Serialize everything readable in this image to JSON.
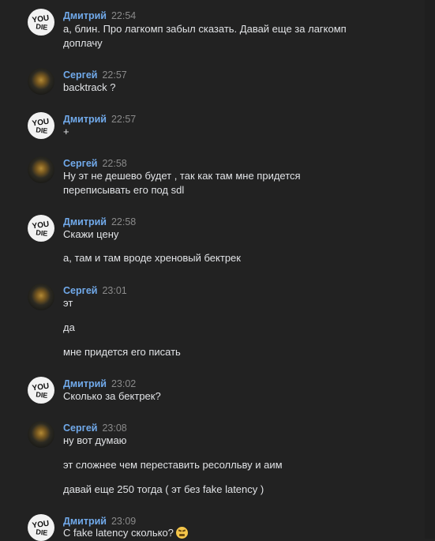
{
  "users": {
    "dmitry": "Дмитрий",
    "sergey": "Сергей"
  },
  "messages": [
    {
      "author": "Дмитрий",
      "time": "22:54",
      "lines": [
        "а, блин. Про лагкомп забыл сказать. Давай еще за лагкомп",
        "доплачу"
      ]
    },
    {
      "author": "Сергей",
      "time": "22:57",
      "lines": [
        "backtrack ?"
      ]
    },
    {
      "author": "Дмитрий",
      "time": "22:57",
      "lines": [
        "+"
      ]
    },
    {
      "author": "Сергей",
      "time": "22:58",
      "lines": [
        "Ну эт не дешево будет , так как там мне придется",
        "переписывать его под sdl"
      ]
    },
    {
      "author": "Дмитрий",
      "time": "22:58",
      "lines": [
        "Скажи цену",
        "а, там и там вроде хреновый бектрек"
      ]
    },
    {
      "author": "Сергей",
      "time": "23:01",
      "lines": [
        "эт",
        "да",
        "мне придется его писать"
      ]
    },
    {
      "author": "Дмитрий",
      "time": "23:02",
      "lines": [
        "Сколько за бектрек?"
      ]
    },
    {
      "author": "Сергей",
      "time": "23:08",
      "lines": [
        "ну вот думаю",
        "эт сложнее чем переставить ресолльву и аим",
        "давай еще 250 тогда ( эт без fake latency )"
      ]
    },
    {
      "author": "Дмитрий",
      "time": "23:09",
      "lines": [
        "С fake latency сколько?"
      ]
    }
  ],
  "avatar_text": {
    "dmitry": "YOU DIE"
  },
  "colors": {
    "background": "#222222",
    "author": "#71aaeb",
    "text": "#e1e3e6",
    "time": "#8a8a8a"
  },
  "icons": {
    "emoji_last": "tired-face-emoji"
  }
}
